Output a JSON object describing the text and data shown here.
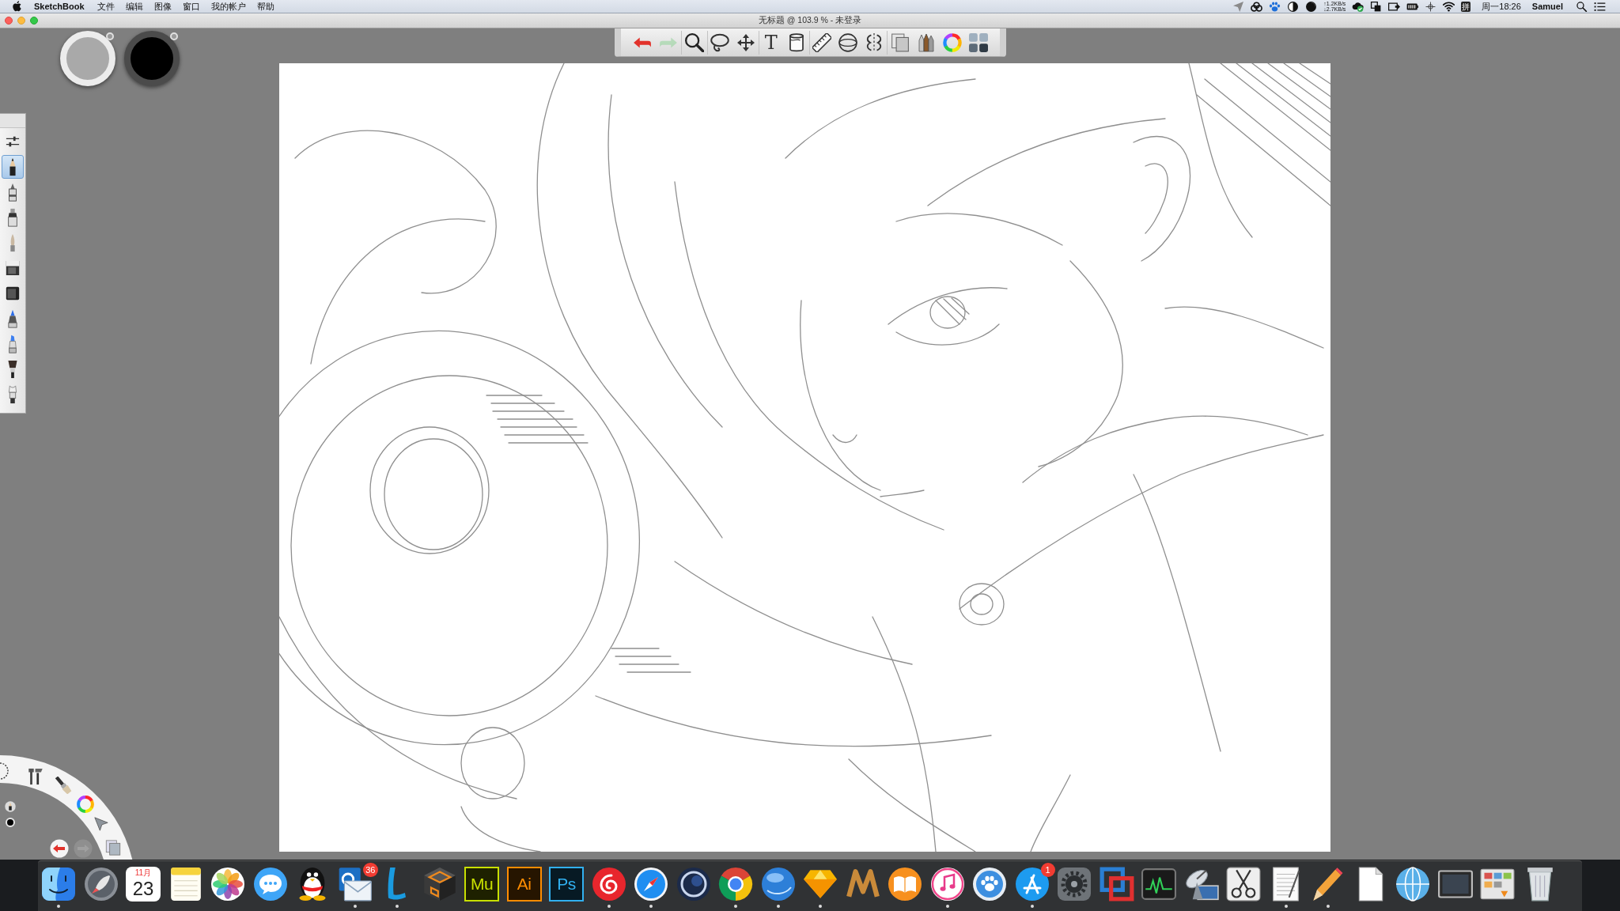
{
  "menu_bar": {
    "app_name": "SketchBook",
    "menus": [
      "文件",
      "编辑",
      "图像",
      "窗口",
      "我的帐户",
      "帮助"
    ],
    "status_items": [
      {
        "kind": "plane"
      },
      {
        "kind": "rings"
      },
      {
        "kind": "paw"
      },
      {
        "kind": "half-circle"
      },
      {
        "kind": "filled-circle"
      },
      {
        "kind": "net-speed",
        "lines": [
          "↑1.2KB/s",
          "↓2.7KB/s"
        ]
      },
      {
        "kind": "cloud-check"
      },
      {
        "kind": "squares"
      },
      {
        "kind": "screen-arrow"
      },
      {
        "kind": "battery"
      },
      {
        "kind": "crosshair"
      },
      {
        "kind": "wifi"
      },
      {
        "kind": "input-source",
        "text": "拼"
      },
      {
        "kind": "clock",
        "text": "周一18:26"
      },
      {
        "kind": "user",
        "text": "Samuel"
      },
      {
        "kind": "search"
      },
      {
        "kind": "list"
      }
    ]
  },
  "window": {
    "title": "无标题 @ 103.9 % - 未登录"
  },
  "toolbar": {
    "groups": [
      {
        "tools": [
          {
            "kind": "undo",
            "disabled": false
          },
          {
            "kind": "redo",
            "disabled": true
          }
        ]
      },
      {
        "tools": [
          {
            "kind": "zoom",
            "disabled": false
          }
        ]
      },
      {
        "tools": [
          {
            "kind": "lasso",
            "disabled": false
          },
          {
            "kind": "move",
            "disabled": false
          }
        ]
      },
      {
        "tools": [
          {
            "kind": "text",
            "glyph": "T",
            "disabled": false
          },
          {
            "kind": "fill",
            "disabled": false
          }
        ]
      },
      {
        "tools": [
          {
            "kind": "ruler",
            "disabled": false
          },
          {
            "kind": "ellipse",
            "disabled": false
          },
          {
            "kind": "symmetry",
            "disabled": false
          }
        ]
      },
      {
        "tools": [
          {
            "kind": "layers",
            "disabled": false
          },
          {
            "kind": "brushes",
            "disabled": false
          },
          {
            "kind": "color-wheel",
            "disabled": false
          },
          {
            "kind": "grid",
            "disabled": false
          }
        ]
      }
    ]
  },
  "pucks": [
    {
      "kind": "brush",
      "color": "#a9a9a9"
    },
    {
      "kind": "color",
      "color": "#000000"
    }
  ],
  "brush_palette": {
    "tools": [
      {
        "kind": "sliders",
        "selected": false
      },
      {
        "kind": "pencil",
        "selected": true
      },
      {
        "kind": "fineliner",
        "selected": false
      },
      {
        "kind": "marker",
        "selected": false
      },
      {
        "kind": "brush-tip",
        "selected": false
      },
      {
        "kind": "block-light",
        "selected": false
      },
      {
        "kind": "block-dark",
        "selected": false
      },
      {
        "kind": "blue-marker",
        "selected": false
      },
      {
        "kind": "blue-chisel",
        "selected": false
      },
      {
        "kind": "brush",
        "selected": false
      },
      {
        "kind": "airbrush",
        "selected": false
      }
    ]
  },
  "lagoon": {
    "items": [
      {
        "kind": "ring",
        "disabled": false
      },
      {
        "kind": "tools",
        "disabled": false
      },
      {
        "kind": "brush",
        "disabled": false
      },
      {
        "kind": "color-wheel",
        "disabled": false
      },
      {
        "kind": "select",
        "disabled": false
      },
      {
        "kind": "layers",
        "disabled": false
      },
      {
        "kind": "undo",
        "disabled": false
      },
      {
        "kind": "redo",
        "disabled": true
      }
    ],
    "indicators": [
      {
        "kind": "brush"
      },
      {
        "kind": "color",
        "color": "#000000"
      }
    ]
  },
  "dock": {
    "items": [
      {
        "kind": "face",
        "running": true
      },
      {
        "kind": "rocket",
        "running": false
      },
      {
        "kind": "calendar",
        "month": "11月",
        "day": "23",
        "running": false
      },
      {
        "kind": "notepad",
        "running": false
      },
      {
        "kind": "flower",
        "running": false
      },
      {
        "kind": "chat",
        "running": false
      },
      {
        "kind": "penguin",
        "running": false
      },
      {
        "kind": "mail",
        "badge": "36",
        "running": true
      },
      {
        "kind": "lshape",
        "running": true
      },
      {
        "kind": "box",
        "running": false
      },
      {
        "kind": "tile",
        "text": "Mu",
        "color": "#c8e000",
        "running": false
      },
      {
        "kind": "tile",
        "text": "Ai",
        "color": "#ff8c00",
        "running": false
      },
      {
        "kind": "tile",
        "text": "Ps",
        "color": "#31b0f0",
        "running": false
      },
      {
        "kind": "swirl",
        "running": true
      },
      {
        "kind": "compass",
        "running": true
      },
      {
        "kind": "sphere",
        "running": false
      },
      {
        "kind": "wheel",
        "running": true
      },
      {
        "kind": "orb",
        "running": true
      },
      {
        "kind": "diamond",
        "running": true
      },
      {
        "kind": "zigzag",
        "running": false
      },
      {
        "kind": "book",
        "running": false
      },
      {
        "kind": "note",
        "running": true
      },
      {
        "kind": "paw",
        "running": false
      },
      {
        "kind": "tools",
        "badge": "1",
        "running": true
      },
      {
        "kind": "gear",
        "running": false
      },
      {
        "kind": "squares",
        "running": false
      },
      {
        "kind": "graph",
        "running": false
      },
      {
        "kind": "dish",
        "running": false
      },
      {
        "kind": "scissors",
        "running": false
      },
      {
        "kind": "paper",
        "running": true
      },
      {
        "kind": "pencil",
        "running": true
      },
      {
        "kind": "document",
        "running": false
      },
      {
        "kind": "globe",
        "running": false
      },
      {
        "kind": "screen",
        "running": false
      },
      {
        "kind": "thumbnails",
        "running": false
      },
      {
        "kind": "trash",
        "running": false
      }
    ]
  }
}
